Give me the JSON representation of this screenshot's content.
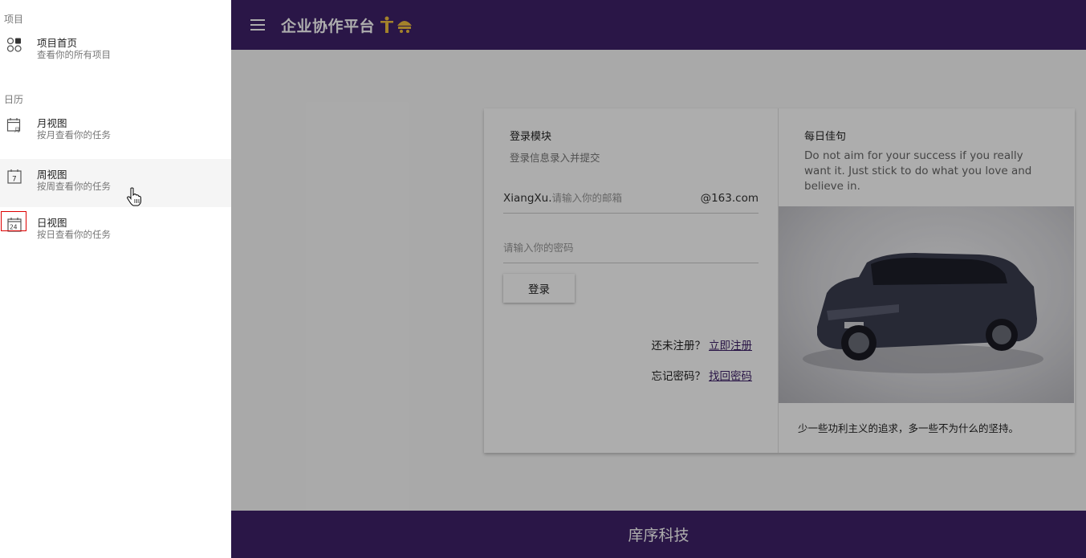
{
  "toolbar": {
    "title": "企业协作平台",
    "menu_icon": "hamburger-menu-icon"
  },
  "footer": {
    "text": "庠序科技"
  },
  "login": {
    "title": "登录模块",
    "subtitle": "登录信息录入并提交",
    "email_prefix": "XiangXu.",
    "email_placeholder": "请输入你的邮箱",
    "email_suffix": "@163.com",
    "password_placeholder": "请输入你的密码",
    "submit_label": "登录",
    "register_prompt": "还未注册？",
    "register_link": "立即注册",
    "forgot_prompt": "忘记密码？",
    "forgot_link": "找回密码"
  },
  "quote": {
    "title": "每日佳句",
    "text": "Do not aim for your success if you really want it. Just stick to do what you love and believe in.",
    "caption": "少一些功利主义的追求，多一些不为什么的坚持。"
  },
  "drawer": {
    "sections": [
      {
        "header": "项目",
        "items": [
          {
            "label": "项目首页",
            "desc": "查看你的所有项目",
            "icon": "projects-icon"
          }
        ]
      },
      {
        "header": "日历",
        "items": [
          {
            "label": "月视图",
            "desc": "按月查看你的任务",
            "icon": "month-view-icon"
          },
          {
            "label": "周视图",
            "desc": "按周查看你的任务",
            "icon": "week-view-icon",
            "active": true
          },
          {
            "label": "日视图",
            "desc": "按日查看你的任务",
            "icon": "day-view-icon"
          }
        ]
      }
    ]
  },
  "colors": {
    "primary": "#3f2169",
    "backdrop": "rgba(0,0,0,0.32)"
  }
}
